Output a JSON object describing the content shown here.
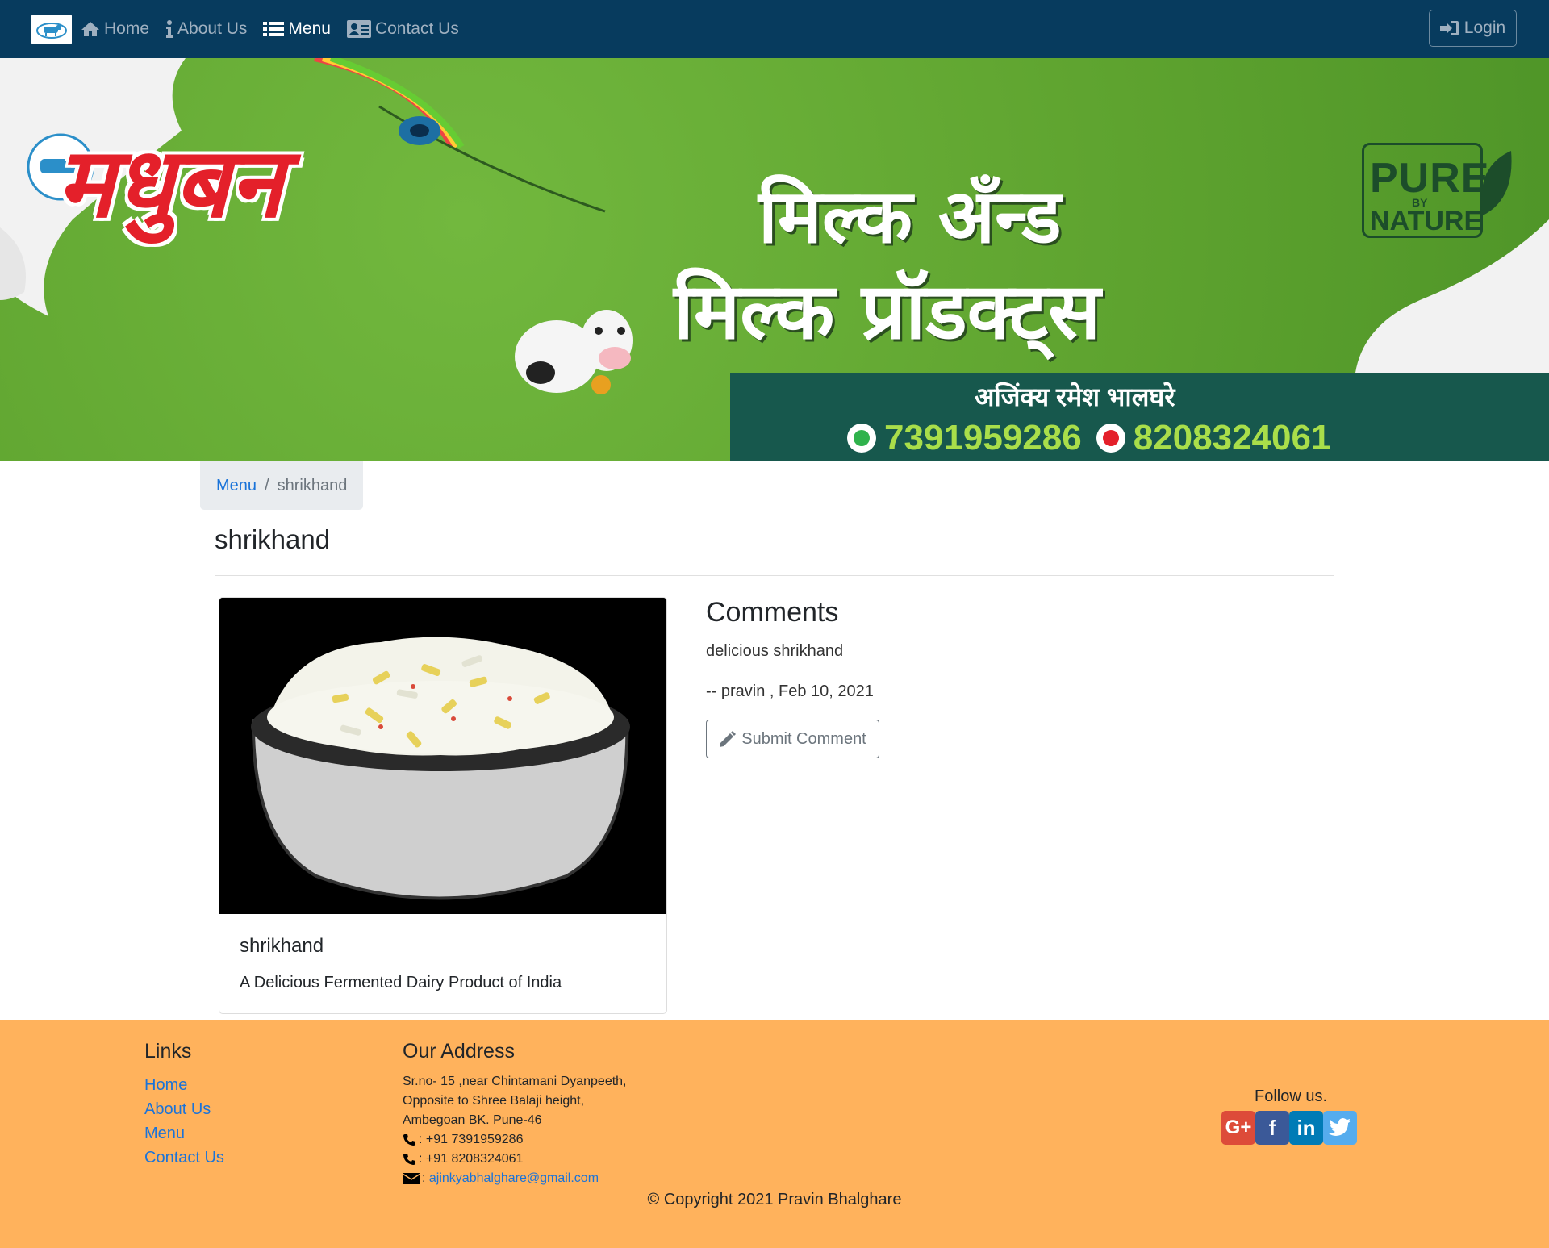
{
  "nav": {
    "items": [
      {
        "label": "Home",
        "icon": "home-icon"
      },
      {
        "label": "About Us",
        "icon": "info-icon"
      },
      {
        "label": "Menu",
        "icon": "list-icon"
      },
      {
        "label": "Contact Us",
        "icon": "address-card-icon"
      }
    ],
    "active": "Menu",
    "login_label": "Login"
  },
  "banner": {
    "brand": "मधुबन",
    "line1": "मिल्क अँन्ड",
    "line2": "मिल्क प्रॉडक्ट्स",
    "owner": "अजिंक्य रमेश भालघरे",
    "phone1": "7391959286",
    "phone2": "8208324061",
    "badge_top": "PURE",
    "badge_by": "BY",
    "badge_bottom": "NATURE"
  },
  "breadcrumb": {
    "parent": "Menu",
    "separator": "/",
    "current": "shrikhand"
  },
  "dish": {
    "title": "shrikhand",
    "card_title": "shrikhand",
    "description": "A Delicious Fermented Dairy Product of India"
  },
  "comments": {
    "heading": "Comments",
    "items": [
      {
        "text": "delicious shrikhand",
        "meta": "-- pravin , Feb 10, 2021"
      }
    ],
    "submit_label": "Submit Comment"
  },
  "footer": {
    "links_heading": "Links",
    "links": [
      "Home",
      "About Us",
      "Menu",
      "Contact Us"
    ],
    "address_heading": "Our Address",
    "address_lines": [
      "Sr.no- 15 ,near Chintamani Dyanpeeth,",
      "Opposite to Shree Balaji height,",
      "Ambegoan BK. Pune-46"
    ],
    "phone1": ": +91 7391959286",
    "phone2": ": +91 8208324061",
    "email_prefix": ": ",
    "email": "ajinkyabhalghare@gmail.com",
    "follow": "Follow us.",
    "social": [
      "google-plus-icon",
      "facebook-icon",
      "linkedin-icon",
      "twitter-icon"
    ],
    "copyright": "© Copyright 2021 Pravin Bhalghare"
  },
  "colors": {
    "navbar": "#073b5e",
    "footer": "#ffb25c",
    "link": "#1a73d9"
  }
}
